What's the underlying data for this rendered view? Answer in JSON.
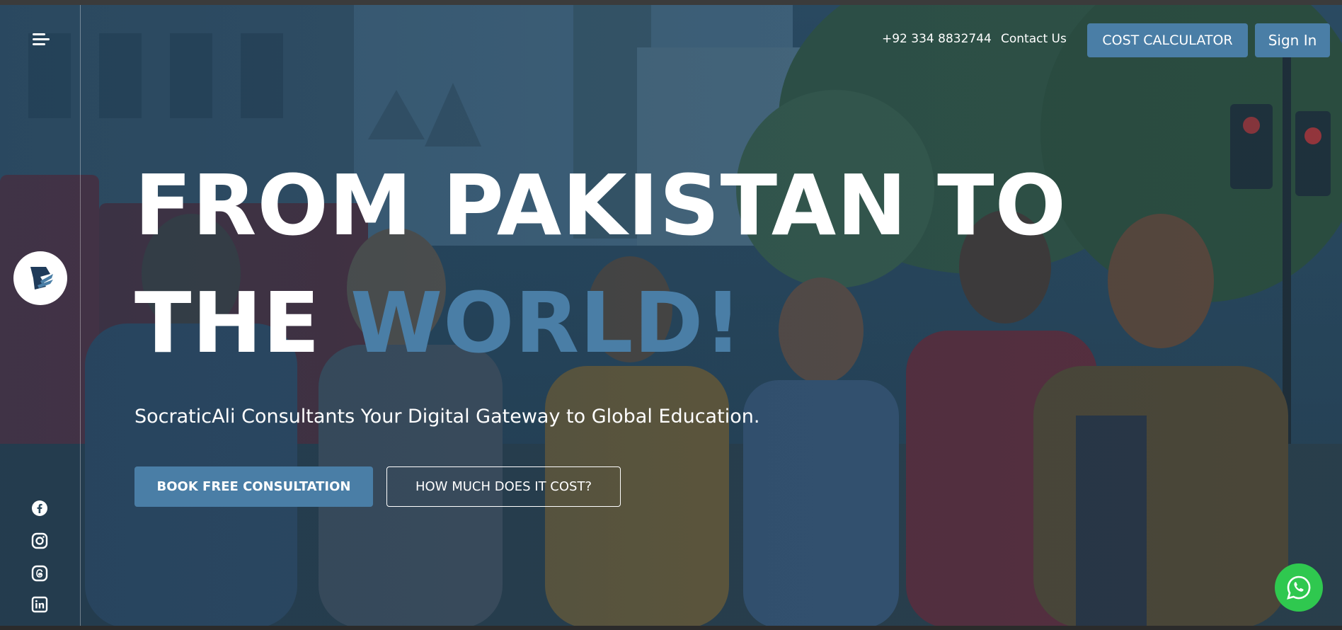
{
  "nav": {
    "phone": "+92 334 8832744",
    "contact": "Contact Us",
    "cost_calculator": "COST CALCULATOR",
    "sign_in": "Sign In"
  },
  "hero": {
    "line1": "FROM PAKISTAN TO",
    "line2_prefix": "THE ",
    "line2_accent": "WORLD!",
    "subtitle": "SocraticAli Consultants Your Digital Gateway to Global Education.",
    "cta_primary": "BOOK FREE CONSULTATION",
    "cta_secondary": "HOW MUCH DOES IT COST?"
  },
  "sidebar": {
    "icons": [
      "menu-icon",
      "logo",
      "facebook-icon",
      "instagram-icon",
      "threads-icon",
      "linkedin-icon"
    ]
  },
  "colors": {
    "accent": "#4a7ea6",
    "whatsapp": "#2fc84f"
  }
}
